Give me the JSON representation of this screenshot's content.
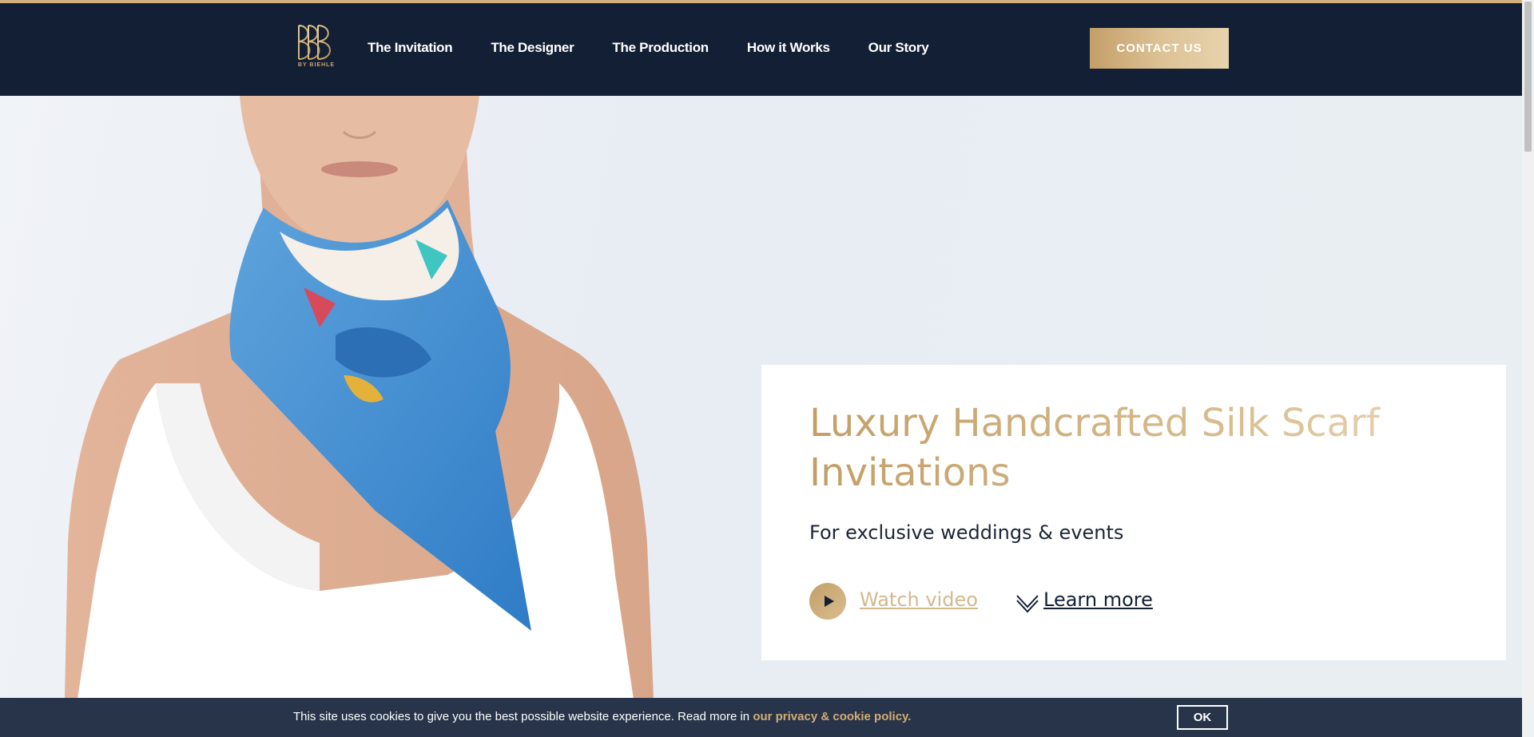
{
  "brand": {
    "logo_sub": "BY BIEHLE",
    "accent": "#c9a46e",
    "navy": "#131f35"
  },
  "nav": {
    "items": [
      {
        "label": "The Invitation"
      },
      {
        "label": "The Designer"
      },
      {
        "label": "The Production"
      },
      {
        "label": "How it Works"
      },
      {
        "label": "Our Story"
      }
    ],
    "contact_label": "CONTACT US"
  },
  "hero": {
    "title": "Luxury Handcrafted Silk Scarf Invitations",
    "subtitle": "For exclusive weddings & events",
    "watch_label": "Watch video",
    "learn_label": "Learn more",
    "image": "woman-wearing-blue-silk-scarf"
  },
  "cookie": {
    "text": "This site uses cookies to give you the best possible website experience. Read more in ",
    "link_label": "our privacy & cookie policy.",
    "ok_label": "OK"
  }
}
